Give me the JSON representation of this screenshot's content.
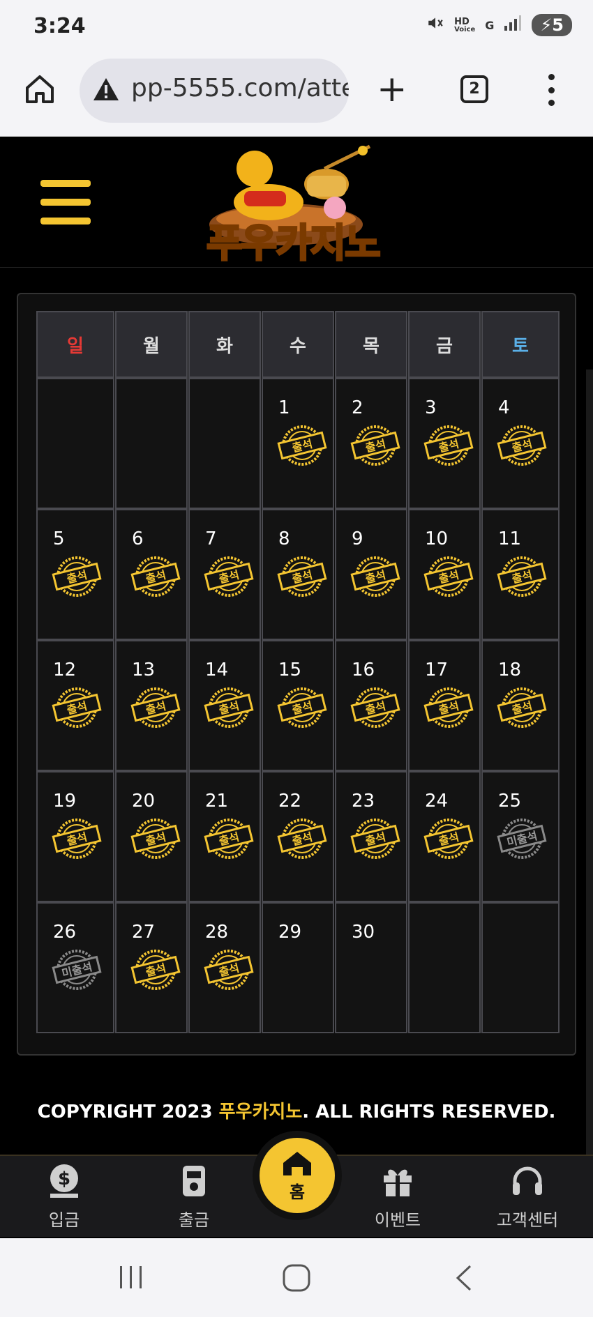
{
  "status": {
    "time": "3:24",
    "battery": "5",
    "hd_label": "HD",
    "voice_label": "Voice",
    "network": "G"
  },
  "browser": {
    "url": "pp-5555.com/atte",
    "tab_count": "2"
  },
  "site": {
    "logo_text": "푸우카지노"
  },
  "calendar": {
    "weekdays": [
      "일",
      "월",
      "화",
      "수",
      "목",
      "금",
      "토"
    ],
    "leading_blanks": 3,
    "days": [
      {
        "day": "1",
        "stamp": "출석",
        "status": "attended"
      },
      {
        "day": "2",
        "stamp": "출석",
        "status": "attended"
      },
      {
        "day": "3",
        "stamp": "출석",
        "status": "attended"
      },
      {
        "day": "4",
        "stamp": "출석",
        "status": "attended"
      },
      {
        "day": "5",
        "stamp": "출석",
        "status": "attended"
      },
      {
        "day": "6",
        "stamp": "출석",
        "status": "attended"
      },
      {
        "day": "7",
        "stamp": "출석",
        "status": "attended"
      },
      {
        "day": "8",
        "stamp": "출석",
        "status": "attended"
      },
      {
        "day": "9",
        "stamp": "출석",
        "status": "attended"
      },
      {
        "day": "10",
        "stamp": "출석",
        "status": "attended"
      },
      {
        "day": "11",
        "stamp": "출석",
        "status": "attended"
      },
      {
        "day": "12",
        "stamp": "출석",
        "status": "attended"
      },
      {
        "day": "13",
        "stamp": "출석",
        "status": "attended"
      },
      {
        "day": "14",
        "stamp": "출석",
        "status": "attended"
      },
      {
        "day": "15",
        "stamp": "출석",
        "status": "attended"
      },
      {
        "day": "16",
        "stamp": "출석",
        "status": "attended"
      },
      {
        "day": "17",
        "stamp": "출석",
        "status": "attended"
      },
      {
        "day": "18",
        "stamp": "출석",
        "status": "attended"
      },
      {
        "day": "19",
        "stamp": "출석",
        "status": "attended"
      },
      {
        "day": "20",
        "stamp": "출석",
        "status": "attended"
      },
      {
        "day": "21",
        "stamp": "출석",
        "status": "attended"
      },
      {
        "day": "22",
        "stamp": "출석",
        "status": "attended"
      },
      {
        "day": "23",
        "stamp": "출석",
        "status": "attended"
      },
      {
        "day": "24",
        "stamp": "출석",
        "status": "attended"
      },
      {
        "day": "25",
        "stamp": "미출석",
        "status": "missed"
      },
      {
        "day": "26",
        "stamp": "미출석",
        "status": "missed"
      },
      {
        "day": "27",
        "stamp": "출석",
        "status": "attended"
      },
      {
        "day": "28",
        "stamp": "출석",
        "status": "attended"
      },
      {
        "day": "29",
        "stamp": "",
        "status": "none"
      },
      {
        "day": "30",
        "stamp": "",
        "status": "none"
      }
    ],
    "trailing_blanks": 2
  },
  "footer": {
    "copyright_prefix": "COPYRIGHT 2023 ",
    "brand": "푸우카지노",
    "copyright_suffix": ". ALL RIGHTS RESERVED."
  },
  "bottom_nav": {
    "deposit": "입금",
    "withdraw": "출금",
    "home": "홈",
    "event": "이벤트",
    "support": "고객센터"
  },
  "colors": {
    "accent": "#f4c531",
    "sunday": "#e53935",
    "saturday": "#5ab0e8"
  }
}
